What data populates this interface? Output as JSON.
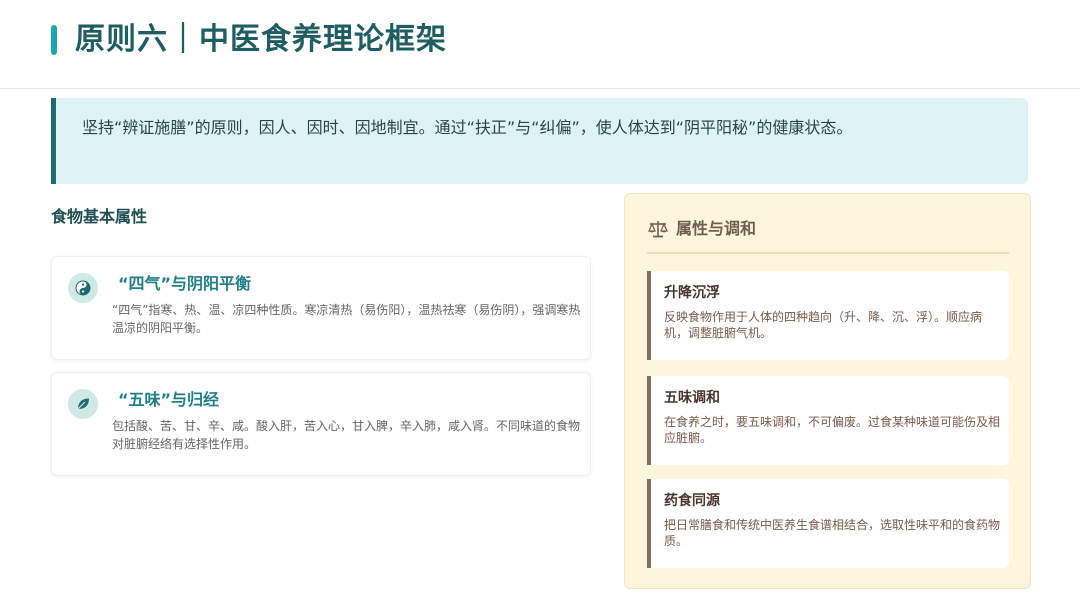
{
  "header": {
    "title": "原则六｜中医食养理论框架",
    "accent_color": "#1aa6b7",
    "title_color": "#1e5e63"
  },
  "intro": {
    "text": "坚持“辨证施膳”的原则，因人、因时、因地制宜。通过“扶正”与“纠偏”，使人体达到“阴平阳秘”的健康状态。",
    "background_color": "#def3f6",
    "border_color": "#1e6b70"
  },
  "left_section": {
    "title": "食物基本属性",
    "cards": [
      {
        "icon": "yin-yang-icon",
        "title": "“四气”与阴阳平衡",
        "description": "“四气”指寒、热、温、凉四种性质。寒凉清热（易伤阳），温热祛寒（易伤阴），强调寒热温凉的阴阳平衡。"
      },
      {
        "icon": "leaf-icon",
        "title": "“五味”与归经",
        "description": "包括酸、苦、甘、辛、咸。酸入肝，苦入心，甘入脾，辛入肺，咸入肾。不同味道的食物对脏腑经络有选择性作用。"
      }
    ]
  },
  "right_panel": {
    "icon": "balance-scale-icon",
    "title": "属性与调和",
    "background_color": "#fdf6dd",
    "items": [
      {
        "title": "升降沉浮",
        "description": "反映食物作用于人体的四种趋向（升、降、沉、浮）。顺应病机，调整脏腑气机。"
      },
      {
        "title": "五味调和",
        "description": "在食养之时，要五味调和，不可偏废。过食某种味道可能伤及相应脏腑。"
      },
      {
        "title": "药食同源",
        "description": "把日常膳食和传统中医养生食谱相结合，选取性味平和的食药物质。"
      }
    ]
  }
}
